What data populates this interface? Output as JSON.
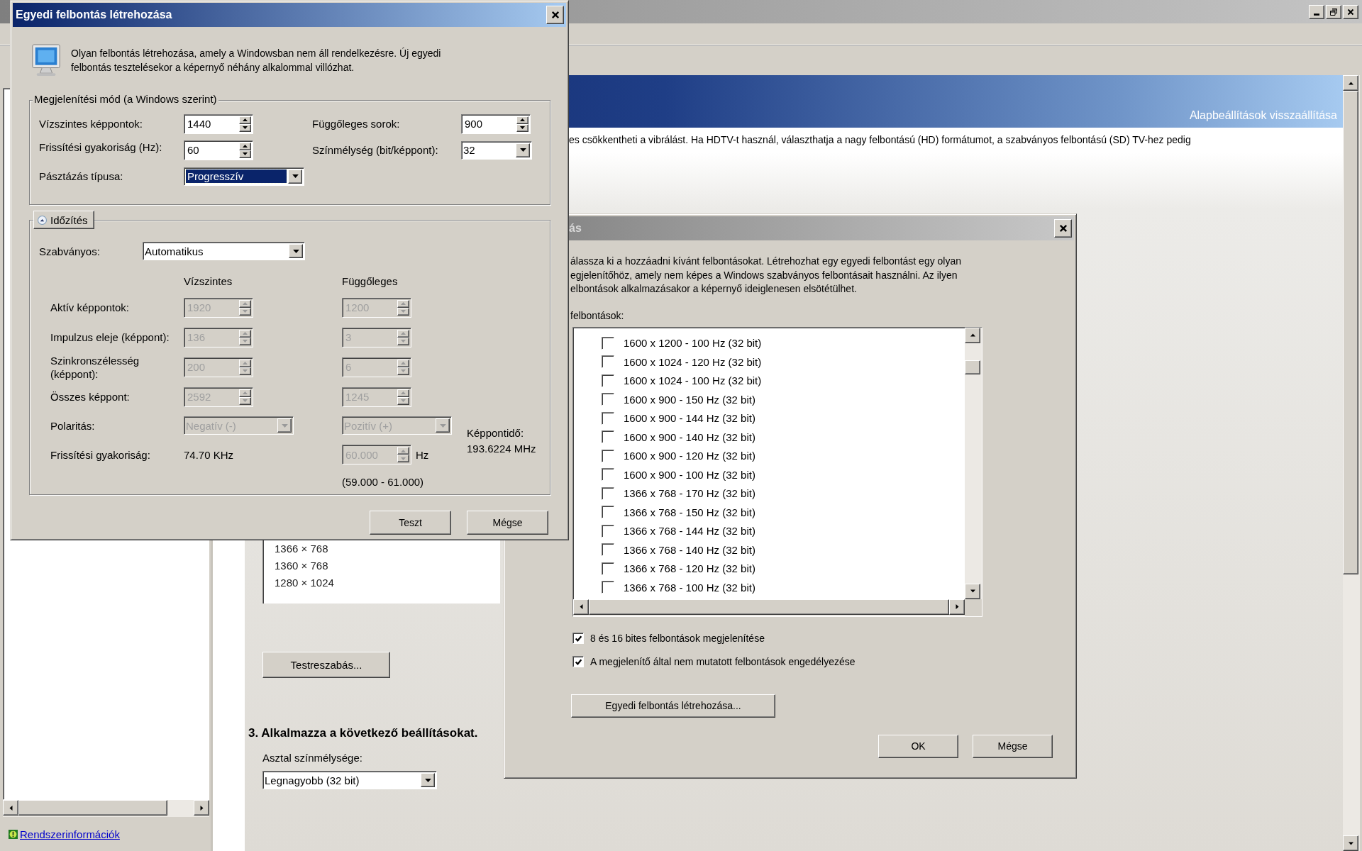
{
  "main_window": {
    "banner_link": "Alapbeállítások visszaállítása",
    "body_text": "es csökkentheti a vibrálást. Ha HDTV-t használ, választhatja a nagy felbontású (HD) formátumot, a szabványos felbontású (SD) TV-hez pedig",
    "resolution_list": [
      "1366 × 768",
      "1360 × 768",
      "1280 × 1024"
    ],
    "customize_button": "Testreszabás...",
    "step_heading": "3. Alkalmazza a következő beállításokat.",
    "color_depth": {
      "label": "Asztal színmélysége:",
      "value": "Legnagyobb (32 bit)"
    },
    "sidebar_link": "Rendszerinformációk"
  },
  "resolutions_dialog": {
    "title": "ás",
    "description": [
      "álassza ki a hozzáadni kívánt felbontásokat. Létrehozhat egy egyedi felbontást egy olyan",
      "egjelenítőhöz, amely nem képes a Windows szabványos felbontásait használni. Az ilyen",
      "elbontások alkalmazásakor a képernyő ideiglenesen elsötétülhet."
    ],
    "list_label": "felbontások:",
    "resolutions": [
      {
        "label": "1600 x 1200 - 100 Hz (32 bit)",
        "checked": false
      },
      {
        "label": "1600 x 1024 - 120 Hz (32 bit)",
        "checked": false
      },
      {
        "label": "1600 x 1024 - 100 Hz (32 bit)",
        "checked": false
      },
      {
        "label": "1600 x 900 - 150 Hz (32 bit)",
        "checked": false
      },
      {
        "label": "1600 x 900 - 144 Hz (32 bit)",
        "checked": false
      },
      {
        "label": "1600 x 900 - 140 Hz (32 bit)",
        "checked": false
      },
      {
        "label": "1600 x 900 - 120 Hz (32 bit)",
        "checked": false
      },
      {
        "label": "1600 x 900 - 100 Hz (32 bit)",
        "checked": false
      },
      {
        "label": "1366 x 768 - 170 Hz (32 bit)",
        "checked": false
      },
      {
        "label": "1366 x 768 - 150 Hz (32 bit)",
        "checked": false
      },
      {
        "label": "1366 x 768 - 144 Hz (32 bit)",
        "checked": false
      },
      {
        "label": "1366 x 768 - 140 Hz (32 bit)",
        "checked": false
      },
      {
        "label": "1366 x 768 - 120 Hz (32 bit)",
        "checked": false
      },
      {
        "label": "1366 x 768 - 100 Hz (32 bit)",
        "checked": false
      }
    ],
    "options": [
      {
        "label": "8 és 16 bites felbontások megjelenítése",
        "checked": true
      },
      {
        "label": "A megjelenítő által nem mutatott felbontások engedélyezése",
        "checked": true
      }
    ],
    "create_button": "Egyedi felbontás létrehozása...",
    "buttons": [
      "OK",
      "Mégse"
    ]
  },
  "custom_dialog": {
    "title": "Egyedi felbontás létrehozása",
    "description": "Olyan felbontás létrehozása, amely a Windowsban nem áll rendelkezésre. Új egyedi felbontás tesztelésekor a képernyő néhány alkalommal villózhat.",
    "mode_group": {
      "title": "Megjelenítési mód (a Windows szerint)",
      "fields": [
        {
          "label": "Vízszintes képpontok:",
          "kind": "spin",
          "value": "1440"
        },
        {
          "label": "Függőleges sorok:",
          "kind": "spin",
          "value": "900"
        },
        {
          "label": "Frissítési gyakoriság (Hz):",
          "kind": "spin",
          "value": "60"
        },
        {
          "label": "Színmélység (bit/képpont):",
          "kind": "select",
          "value": "32",
          "focused": false
        },
        {
          "label": "Pásztázás típusa:",
          "kind": "select",
          "value": "Progresszív",
          "focused": true
        }
      ]
    },
    "timing": {
      "toggle": "Időzítés",
      "expanded": true,
      "standard": {
        "label": "Szabványos:",
        "value": "Automatikus"
      },
      "columns": [
        "Vízszintes",
        "Függőleges"
      ],
      "rows": [
        {
          "label": "Aktív képpontok:",
          "h": {
            "kind": "spin",
            "value": "1920",
            "disabled": true
          },
          "v": {
            "kind": "spin",
            "value": "1200",
            "disabled": true
          }
        },
        {
          "label": "Impulzus eleje (képpont):",
          "h": {
            "kind": "spin",
            "value": "136",
            "disabled": true
          },
          "v": {
            "kind": "spin",
            "value": "3",
            "disabled": true
          }
        },
        {
          "label": "Szinkronszélesség\n(képpont):",
          "h": {
            "kind": "spin",
            "value": "200",
            "disabled": true
          },
          "v": {
            "kind": "spin",
            "value": "6",
            "disabled": true
          }
        },
        {
          "label": "Összes képpont:",
          "h": {
            "kind": "spin",
            "value": "2592",
            "disabled": true
          },
          "v": {
            "kind": "spin",
            "value": "1245",
            "disabled": true
          }
        },
        {
          "label": "Polaritás:",
          "h": {
            "kind": "select",
            "value": "Negatív (-)",
            "disabled": true
          },
          "v": {
            "kind": "select",
            "value": "Pozitív (+)",
            "disabled": true
          }
        },
        {
          "label": "Frissítési gyakoriság:",
          "h": {
            "kind": "text",
            "value": "74.70 KHz"
          },
          "v": {
            "kind": "spin",
            "value": "60.000",
            "disabled": true,
            "unit": "Hz"
          }
        }
      ],
      "range": "(59.000 - 61.000)",
      "pixel_clock": {
        "label": "Képpontidő:",
        "value": "193.6224 MHz"
      }
    },
    "buttons": [
      "Teszt",
      "Mégse"
    ]
  }
}
